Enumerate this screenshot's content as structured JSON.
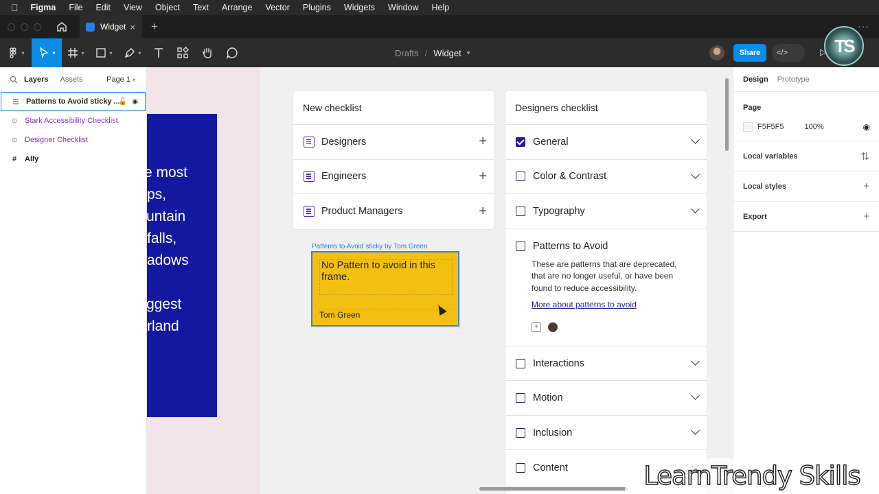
{
  "menubar": {
    "items": [
      "Figma",
      "File",
      "Edit",
      "View",
      "Object",
      "Text",
      "Arrange",
      "Vector",
      "Plugins",
      "Widgets",
      "Window",
      "Help"
    ]
  },
  "tabbar": {
    "tab_title": "Widget",
    "close_glyph": "×",
    "new_tab_glyph": "+",
    "more_glyph": "···"
  },
  "toolbar": {
    "breadcrumb_parent": "Drafts",
    "breadcrumb_separator": "/",
    "file_name": "Widget",
    "share_label": "Share",
    "devmode_label": "</>",
    "icons": [
      "figma-menu-icon",
      "move-icon",
      "frame-icon",
      "rectangle-icon",
      "pen-icon",
      "text-icon",
      "components-icon",
      "hand-icon",
      "comment-icon"
    ]
  },
  "left_panel": {
    "tab_layers": "Layers",
    "tab_assets": "Assets",
    "page_selector": "Page 1",
    "layers": [
      {
        "name": "Patterns to Avoid sticky ...",
        "type": "sticky",
        "selected": true
      },
      {
        "name": "Stark Accessibility Checklist",
        "type": "widget",
        "selected": false
      },
      {
        "name": "Designer Checklist",
        "type": "widget",
        "selected": false
      },
      {
        "name": "Ally",
        "type": "frame",
        "selected": false
      }
    ]
  },
  "canvas": {
    "blue_frame_lines": [
      "e most",
      "ps,",
      "untain",
      "falls,",
      "adows",
      "",
      "ggest",
      "rland"
    ],
    "new_checklist": {
      "title": "New checklist",
      "rows": [
        "Designers",
        "Engineers",
        "Product Managers"
      ],
      "add_glyph": "+"
    },
    "designers_checklist": {
      "title": "Designers checklist",
      "rows_before": [
        {
          "label": "General",
          "checked": true
        },
        {
          "label": "Color & Contrast",
          "checked": false
        },
        {
          "label": "Typography",
          "checked": false
        }
      ],
      "expanded": {
        "label": "Patterns to Avoid",
        "checked": false,
        "description": "These are patterns that are deprecated, that are no longer useful, or have been found to reduce accessibility.",
        "link": "More about patterns to avoid"
      },
      "rows_after": [
        {
          "label": "Interactions",
          "checked": false
        },
        {
          "label": "Motion",
          "checked": false
        },
        {
          "label": "Inclusion",
          "checked": false
        },
        {
          "label": "Content",
          "checked": false
        }
      ]
    },
    "sticky": {
      "label": "Patterns to Avoid sticky by Tom Green",
      "text": "No Pattern to avoid in this frame.",
      "author": "Tom Green",
      "color": "#f3c012"
    }
  },
  "right_panel": {
    "tab_design": "Design",
    "tab_prototype": "Prototype",
    "page_title": "Page",
    "page_color": "F5F5F5",
    "page_opacity": "100%",
    "local_variables": "Local variables",
    "local_styles": "Local styles",
    "export": "Export",
    "add_glyph": "+"
  },
  "overlay": {
    "logo_text": "TS",
    "watermark": "LearnTrendy Skills"
  }
}
